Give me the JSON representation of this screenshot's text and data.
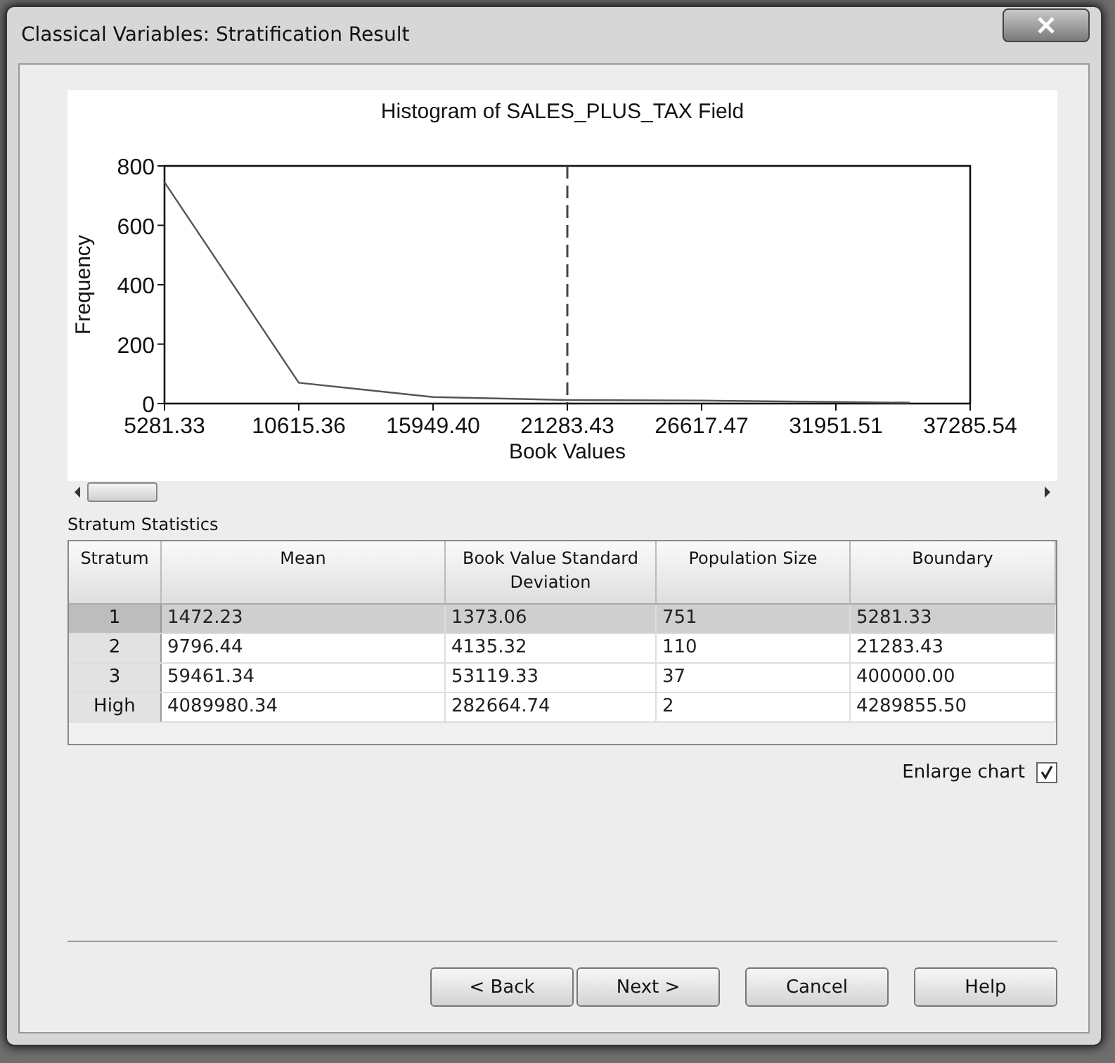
{
  "window": {
    "title": "Classical Variables: Stratification Result"
  },
  "chart": {
    "chart_data": {
      "type": "line",
      "title": "Histogram of SALES_PLUS_TAX Field",
      "xlabel": "Book Values",
      "ylabel": "Frequency",
      "x": [
        5281.33,
        10615.36,
        15949.4,
        21283.43,
        26617.47,
        31951.51,
        34885
      ],
      "series": [
        {
          "color": "#555555",
          "values": [
            745,
            70,
            22,
            12,
            10,
            5,
            3
          ]
        }
      ],
      "xlim": [
        5281.33,
        37285.54
      ],
      "ylim": [
        0,
        800
      ],
      "xticks": [
        {
          "value": 5281.33,
          "label": "5281.33"
        },
        {
          "value": 10615.36,
          "label": "10615.36"
        },
        {
          "value": 15949.4,
          "label": "15949.40"
        },
        {
          "value": 21283.43,
          "label": "21283.43"
        },
        {
          "value": 26617.47,
          "label": "26617.47"
        },
        {
          "value": 31951.51,
          "label": "31951.51"
        },
        {
          "value": 37285.54,
          "label": "37285.54"
        }
      ],
      "yticks": [
        0,
        200,
        400,
        600,
        800
      ],
      "ref_lines": [
        {
          "axis": "x",
          "value": 21283.43
        }
      ]
    }
  },
  "stratum_statistics": {
    "label": "Stratum Statistics",
    "columns": [
      "Stratum",
      "Mean",
      "Book Value Standard Deviation",
      "Population Size",
      "Boundary"
    ],
    "rows": [
      {
        "cells": [
          "1",
          "1472.23",
          "1373.06",
          "751",
          "5281.33"
        ],
        "selected": true
      },
      {
        "cells": [
          "2",
          "9796.44",
          "4135.32",
          "110",
          "21283.43"
        ],
        "selected": false
      },
      {
        "cells": [
          "3",
          "59461.34",
          "53119.33",
          "37",
          "400000.00"
        ],
        "selected": false
      },
      {
        "cells": [
          "High",
          "4089980.34",
          "282664.74",
          "2",
          "4289855.50"
        ],
        "selected": false
      }
    ]
  },
  "enlarge_chart": {
    "label": "Enlarge chart",
    "checked": true
  },
  "buttons": [
    {
      "label": "< Back"
    },
    {
      "label": "Next >"
    },
    {
      "label": "Cancel"
    },
    {
      "label": "Help"
    }
  ]
}
